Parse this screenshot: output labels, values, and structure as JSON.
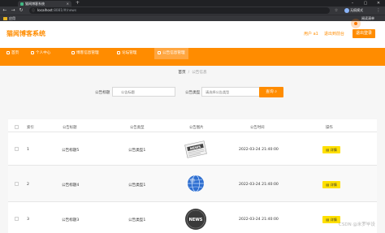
{
  "browser": {
    "tab_title": "猫闻博客系统",
    "url_host": "localhost",
    "url_rest": ":8081/#/news",
    "profile_label": "无痕模式",
    "bookmarks": [
      {
        "label": "应用"
      },
      {
        "label": "阅读清单"
      }
    ]
  },
  "header": {
    "title": "猫闻博客系统",
    "user_label": "用户 a1",
    "back_label": "退出到前台",
    "logout_label": "退出登录"
  },
  "nav": {
    "items": [
      {
        "label": "首页"
      },
      {
        "label": "个人中心"
      },
      {
        "label": "博客信息管理"
      },
      {
        "label": "论坛管理"
      },
      {
        "label": "公告信息管理"
      }
    ]
  },
  "breadcrumb": {
    "home": "首页",
    "separator": "/",
    "current": "公告信息"
  },
  "search": {
    "title_label": "公告标题",
    "title_placeholder": "公告标题",
    "type_label": "公告类型",
    "type_placeholder": "请选择公告类型",
    "query_label": "查询"
  },
  "table": {
    "headers": [
      "索引",
      "公告标题",
      "公告类型",
      "公告图片",
      "公告时间",
      "操作"
    ],
    "rows": [
      {
        "index": "1",
        "title": "公告标题5",
        "type": "公告类型1",
        "image": "news-paper",
        "time": "2022-03-24 21:40:00",
        "action": "详情"
      },
      {
        "index": "2",
        "title": "公告标题4",
        "type": "公告类型1",
        "image": "globe",
        "time": "2022-03-24 21:40:00",
        "action": "详情"
      },
      {
        "index": "3",
        "title": "公告标题3",
        "type": "公告类型1",
        "image": "news-badge",
        "time": "2022-03-24 21:40:00",
        "action": "详情"
      }
    ]
  },
  "watermark": "CSDN @米罗毕设",
  "colors": {
    "primary": "#ff8c00",
    "detail_button": "#ffe000",
    "content_bg": "#f6f6f6"
  }
}
